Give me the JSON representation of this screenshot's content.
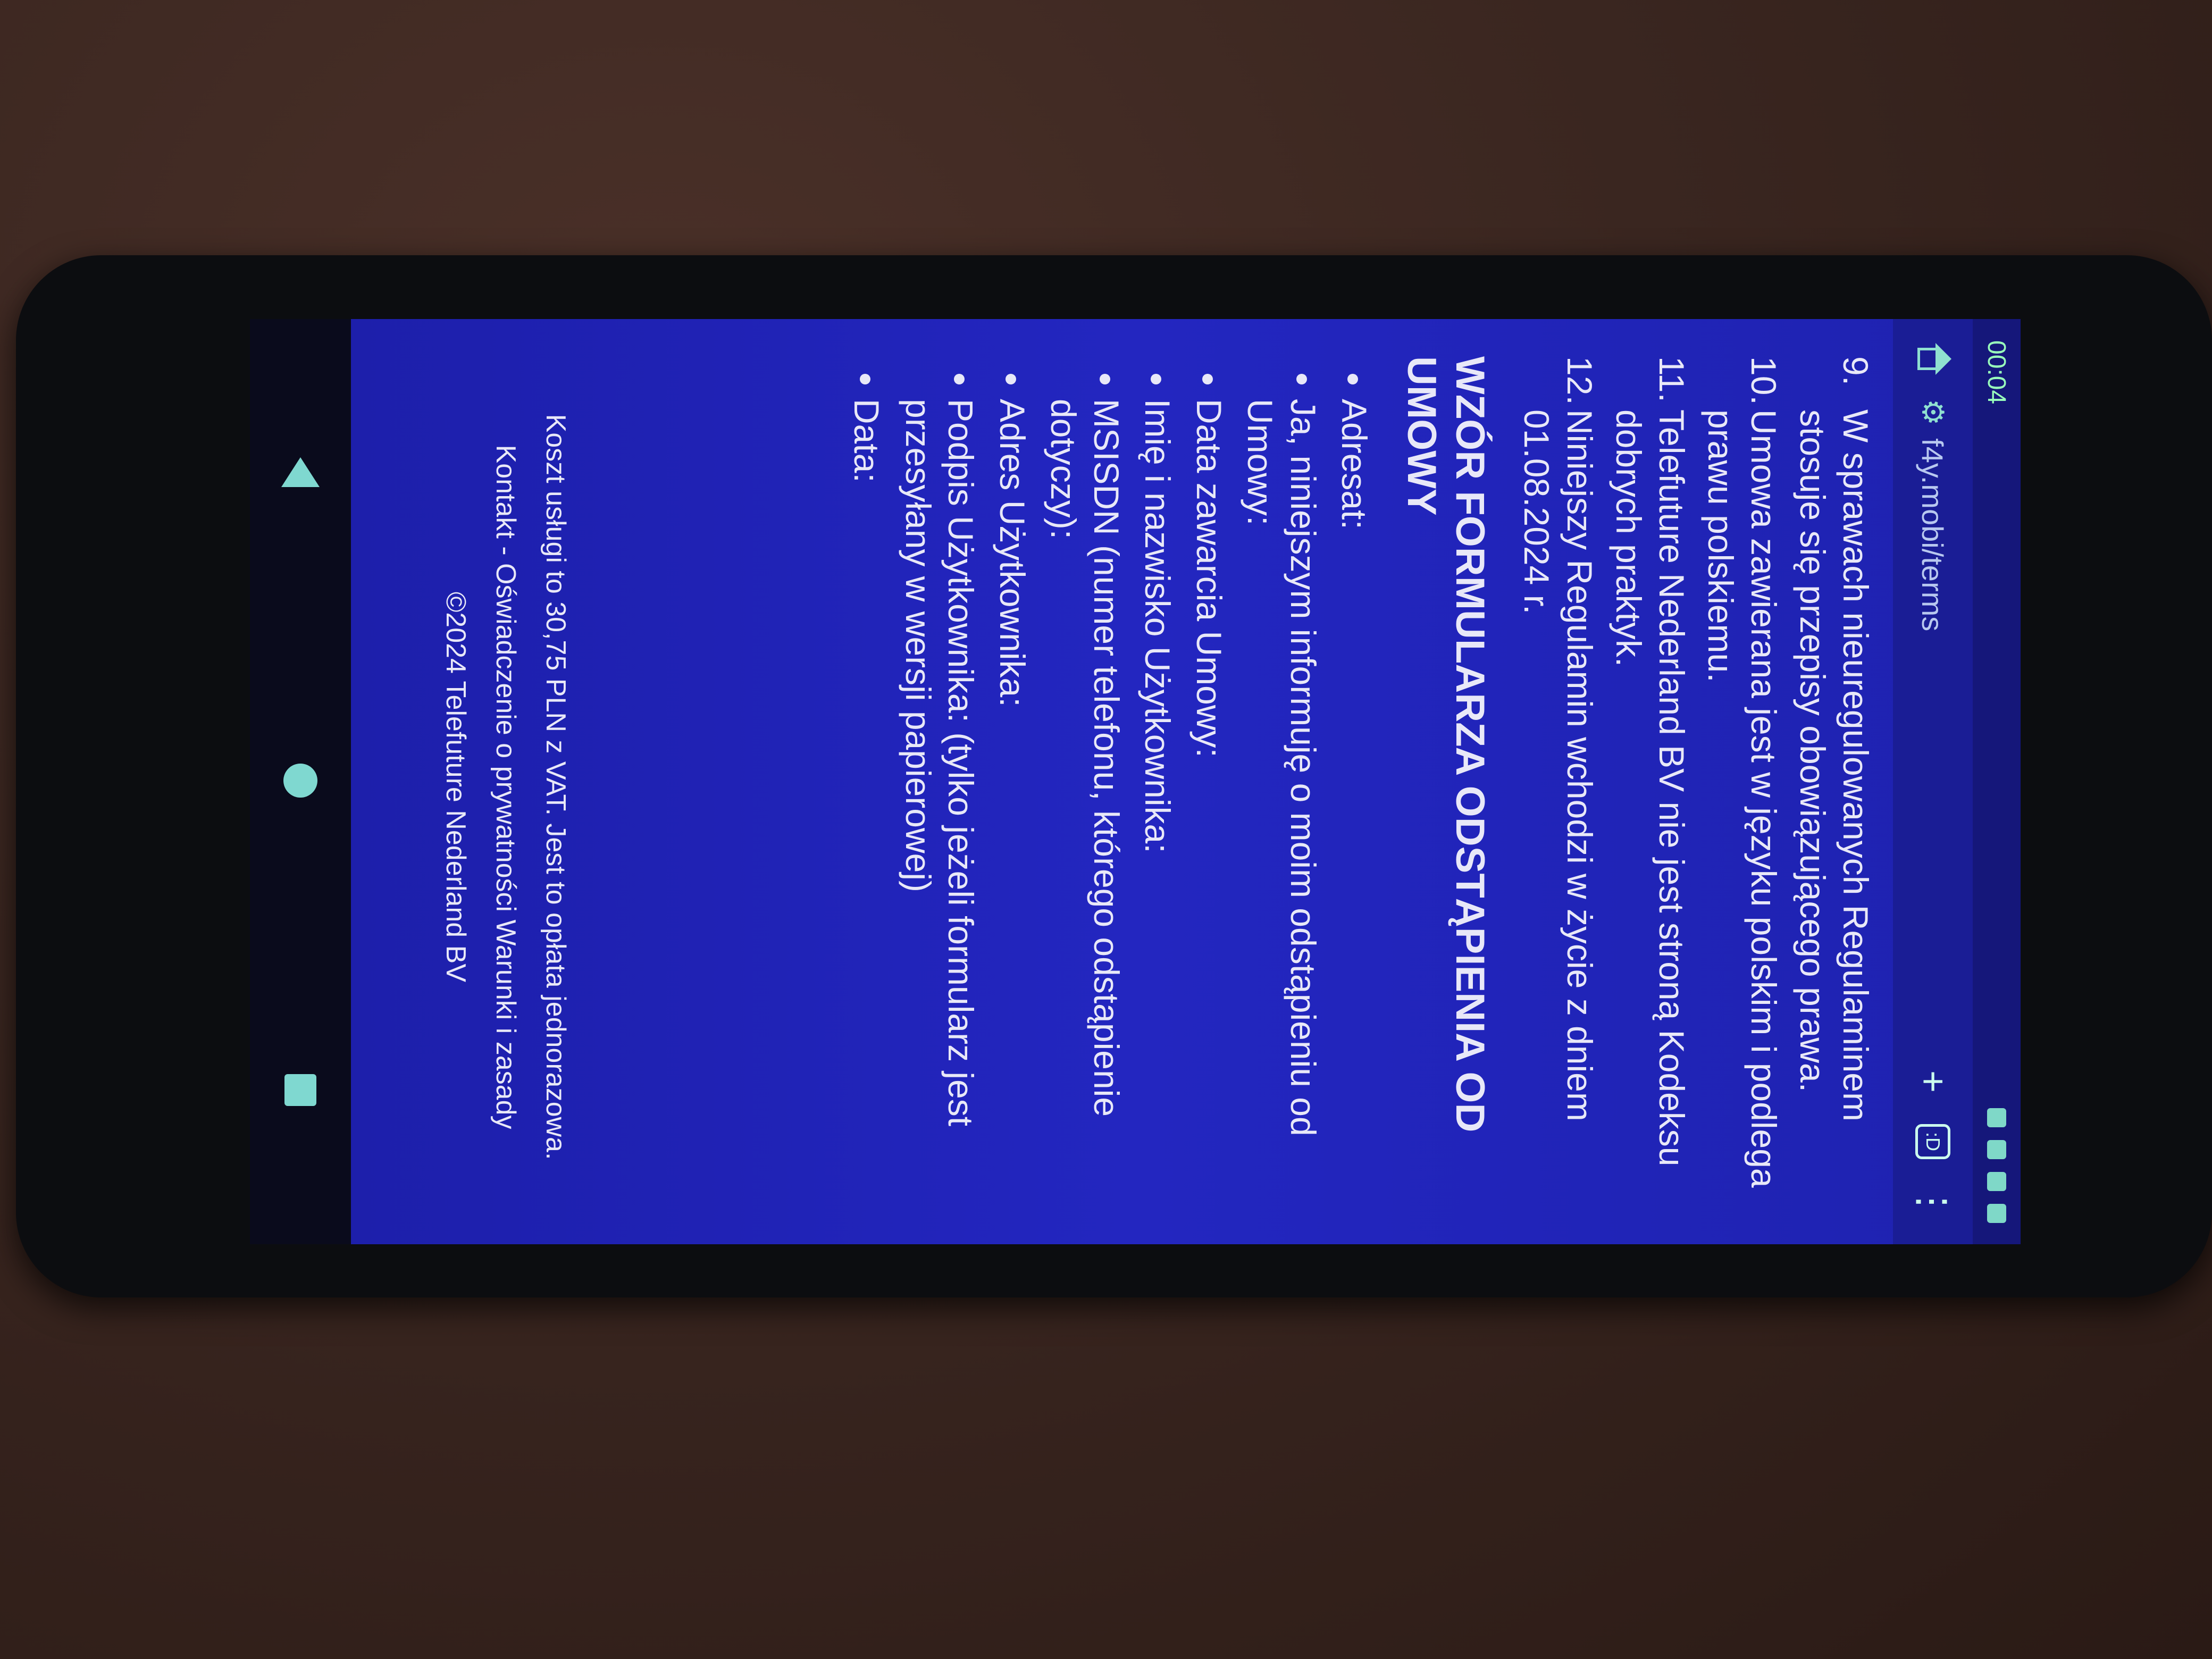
{
  "status": {
    "time": "00:04"
  },
  "browser": {
    "url": "f4y.mobi/terms",
    "tabs_count": ":D",
    "new_tab_label": "+",
    "menu_label": "⋮"
  },
  "terms": {
    "items": [
      {
        "num": "9.",
        "text": "W sprawach nieuregulowanych Regulaminem stosuje się przepisy obowiązującego prawa."
      },
      {
        "num": "10.",
        "text": "Umowa zawierana jest w języku polskim i podlega prawu polskiemu."
      },
      {
        "num": "11.",
        "text": "Telefuture Nederland BV nie jest stroną Kodeksu dobrych praktyk."
      },
      {
        "num": "12.",
        "text": "Niniejszy Regulamin wchodzi w życie z dniem 01.08.2024 r."
      }
    ],
    "form_heading": "WZÓR FORMULARZA ODSTĄPIENIA OD UMOWY",
    "form_fields": [
      "Adresat:",
      "Ja, niniejszym informuję o moim odstąpieniu od Umowy:",
      "Data zawarcia Umowy:",
      "Imię i nazwisko Użytkownika:",
      "MSISDN (numer telefonu, którego odstąpienie dotyczy):",
      "Adres Użytkownika:",
      "Podpis Użytkownika: (tylko jeżeli formularz jest przesyłany w wersji papierowej)",
      "Data:"
    ]
  },
  "footer": {
    "cost": "Koszt usługi to 30,75 PLN z VAT. Jest to opłata jednorazowa.",
    "links": "Kontakt - Oświadczenie o prywatności Warunki i zasady",
    "copyright": "©2024 Telefuture Nederland BV"
  }
}
